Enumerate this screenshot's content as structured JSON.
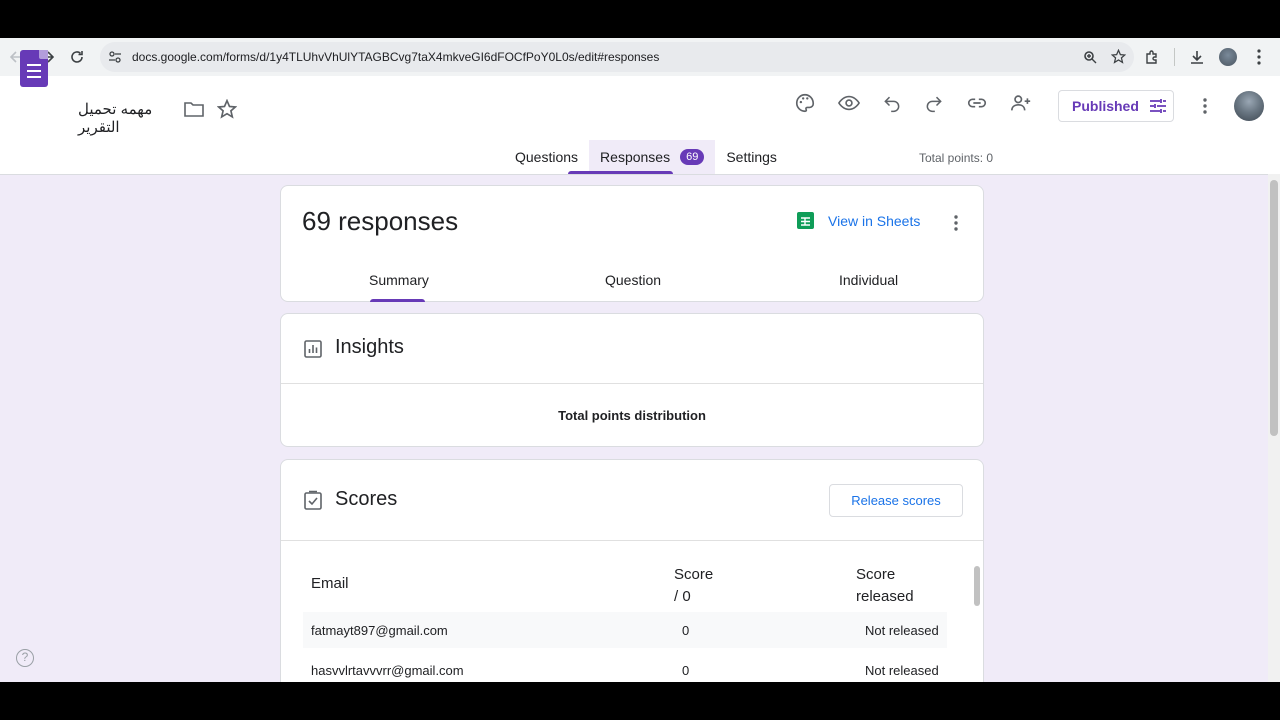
{
  "browser": {
    "url": "docs.google.com/forms/d/1y4TLUhvVhUlYTAGBCvg7taX4mkveGI6dFOCfPoY0L0s/edit#responses"
  },
  "header": {
    "doc_title": "مهمه تحميل التقرير",
    "published_label": "Published"
  },
  "tabs": [
    {
      "label": "Questions"
    },
    {
      "label": "Responses",
      "badge": "69"
    },
    {
      "label": "Settings"
    }
  ],
  "total_points": "Total points: 0",
  "responses_card": {
    "title": "69 responses",
    "view_in_sheets": "View in Sheets",
    "subtabs": [
      "Summary",
      "Question",
      "Individual"
    ]
  },
  "insights": {
    "title": "Insights",
    "subtitle": "Total points distribution"
  },
  "scores": {
    "title": "Scores",
    "release_button": "Release scores",
    "columns": {
      "email": "Email",
      "score_line1": "Score",
      "score_line2": "/ 0",
      "released_line1": "Score",
      "released_line2": "released"
    },
    "rows": [
      {
        "email": "fatmayt897@gmail.com",
        "score": "0",
        "released": "Not released"
      },
      {
        "email": "hasvvlrtavvvrr@gmail.com",
        "score": "0",
        "released": "Not released"
      }
    ]
  },
  "colors": {
    "accent": "#673ab7",
    "background": "#f0ebf8",
    "link": "#1a73e8",
    "sheets_green": "#0f9d58"
  }
}
